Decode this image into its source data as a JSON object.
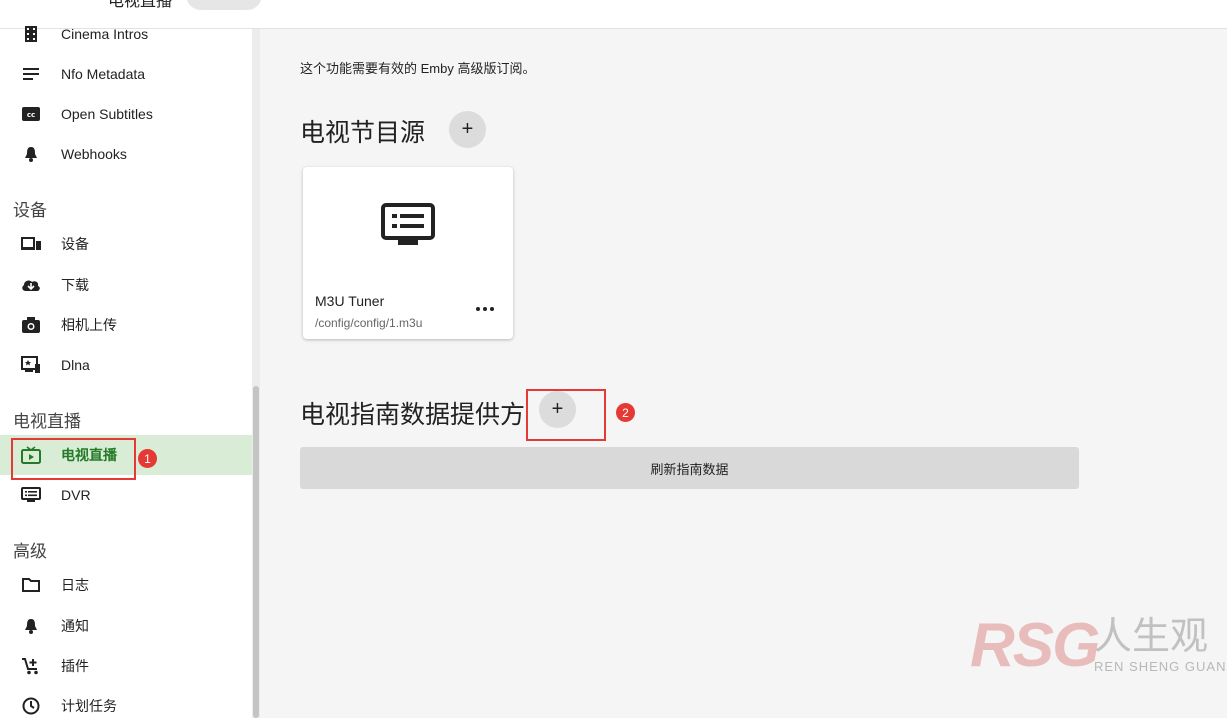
{
  "topbar": {
    "title_fragment": "电视直播"
  },
  "sidebar": {
    "plugin_items": [
      {
        "label": "Cinema Intros",
        "icon": "film-icon"
      },
      {
        "label": "Nfo Metadata",
        "icon": "lines-icon"
      },
      {
        "label": "Open Subtitles",
        "icon": "closed-caption-icon"
      },
      {
        "label": "Webhooks",
        "icon": "bell-icon"
      }
    ],
    "section_devices": "设备",
    "device_items": [
      {
        "label": "设备",
        "icon": "devices-icon"
      },
      {
        "label": "下载",
        "icon": "cloud-download-icon"
      },
      {
        "label": "相机上传",
        "icon": "camera-icon"
      },
      {
        "label": "Dlna",
        "icon": "dlna-icon"
      }
    ],
    "section_livetv": "电视直播",
    "livetv_items": [
      {
        "label": "电视直播",
        "icon": "live-tv-icon",
        "active": true
      },
      {
        "label": "DVR",
        "icon": "dvr-icon"
      }
    ],
    "section_advanced": "高级",
    "advanced_items": [
      {
        "label": "日志",
        "icon": "folder-icon"
      },
      {
        "label": "通知",
        "icon": "bell-icon"
      },
      {
        "label": "插件",
        "icon": "cart-add-icon"
      },
      {
        "label": "计划任务",
        "icon": "clock-icon"
      }
    ]
  },
  "main": {
    "notice": "这个功能需要有效的 Emby 高级版订阅。",
    "tv_sources_title": "电视节目源",
    "add_label": "+",
    "tuner_card": {
      "name": "M3U Tuner",
      "path": "/config/config/1.m3u",
      "icon": "dvr-tv-icon"
    },
    "guide_providers_title": "电视指南数据提供方",
    "refresh_button": "刷新指南数据"
  },
  "annotations": [
    "1",
    "2"
  ],
  "watermark": {
    "logo": "RSG",
    "chinese": "人生观",
    "pinyin": "REN SHENG GUAN"
  },
  "colors": {
    "active_bg": "#d9ecd6",
    "active_text": "#237a27",
    "annotation_red": "#e53935"
  }
}
